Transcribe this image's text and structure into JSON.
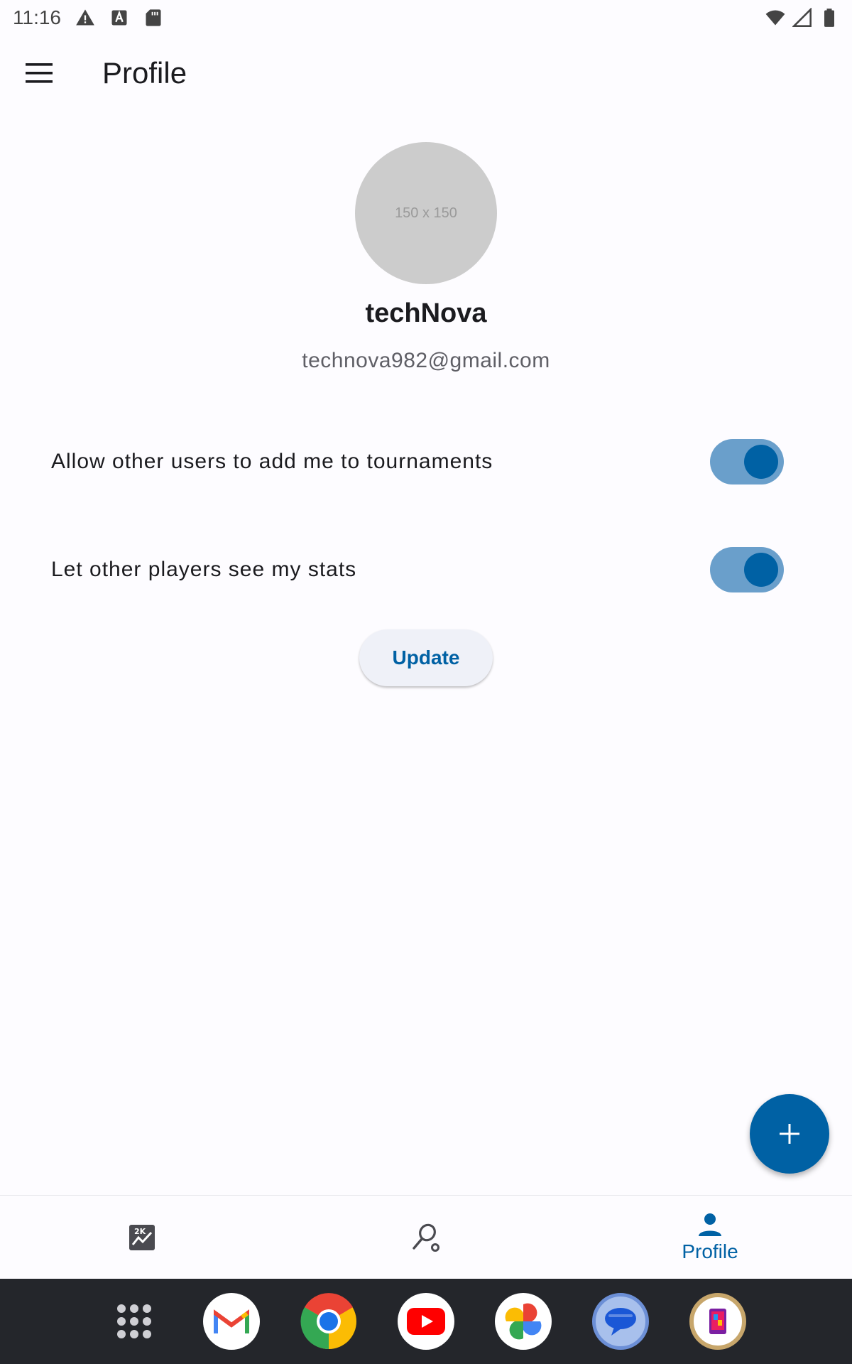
{
  "status_bar": {
    "time": "11:16",
    "icons": [
      "warning-icon",
      "a-notification-icon",
      "sd-card-icon",
      "wifi-icon",
      "signal-icon",
      "battery-icon"
    ]
  },
  "app_bar": {
    "title": "Profile",
    "menu_icon": "hamburger-menu-icon"
  },
  "profile": {
    "avatar_placeholder": "150 x 150",
    "username": "techNova",
    "email": "technova982@gmail.com"
  },
  "settings": [
    {
      "label": "Allow other users to add me to tournaments",
      "enabled": true
    },
    {
      "label": "Let other players see my stats",
      "enabled": true
    }
  ],
  "update_button": "Update",
  "fab_icon": "plus-icon",
  "bottom_nav": {
    "items": [
      {
        "icon": "stats-chart-icon",
        "label": ""
      },
      {
        "icon": "search-racket-icon",
        "label": ""
      },
      {
        "icon": "person-icon",
        "label": "Profile",
        "selected": true
      }
    ]
  },
  "dock": {
    "apps": [
      "app-drawer-icon",
      "gmail-icon",
      "chrome-icon",
      "youtube-icon",
      "photos-icon",
      "messages-icon",
      "gallery-app-icon"
    ]
  },
  "colors": {
    "primary": "#0061a4",
    "switch_track": "#6a9fcb",
    "background": "#fdfcff",
    "dock": "#24262b"
  }
}
